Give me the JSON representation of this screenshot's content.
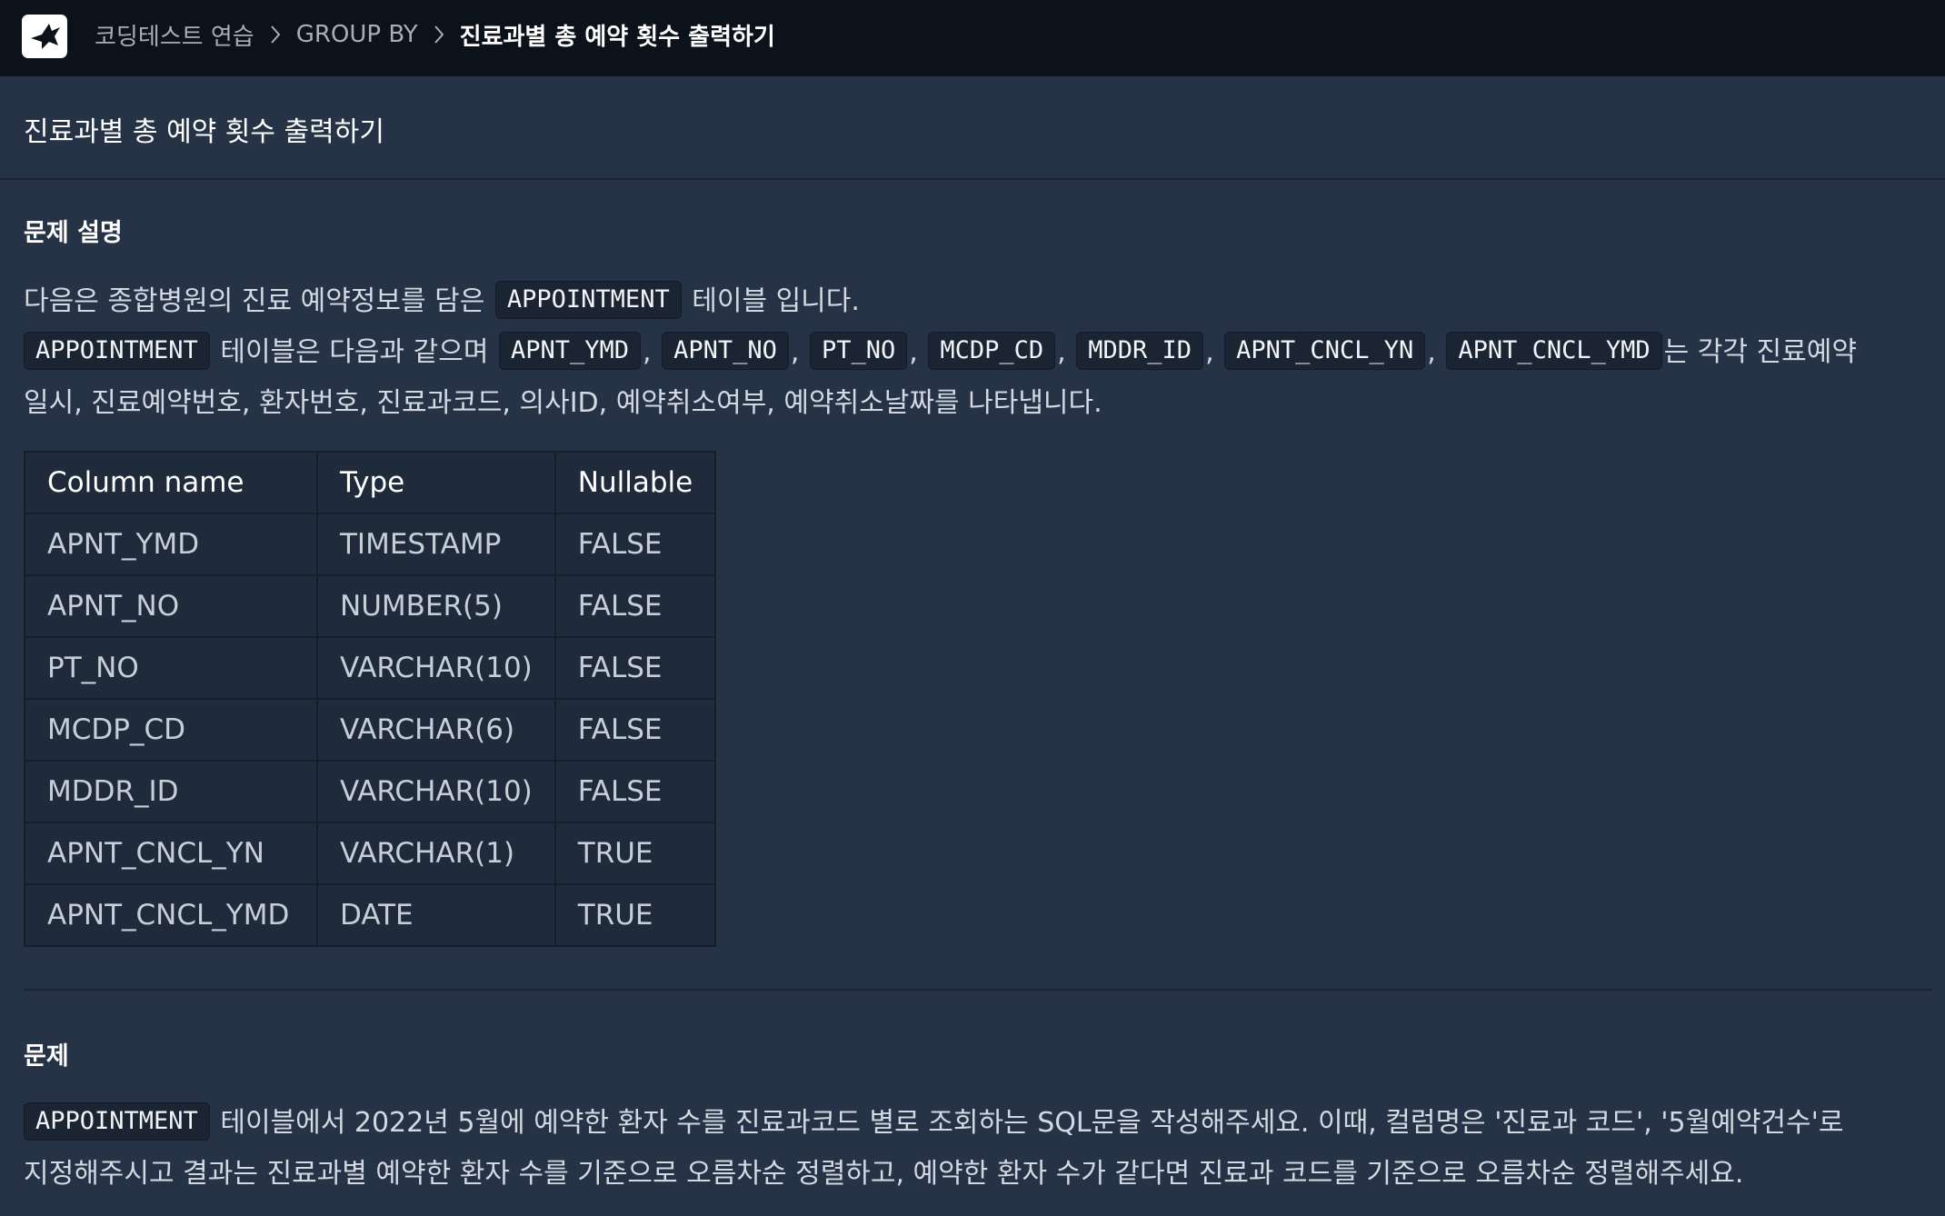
{
  "breadcrumb": {
    "items": [
      "코딩테스트 연습",
      "GROUP BY",
      "진료과별 총 예약 횟수 출력하기"
    ]
  },
  "icons": {
    "logo": "programmers-bird-logo",
    "separator": "chevron-right-icon"
  },
  "page": {
    "title": "진료과별 총 예약 횟수 출력하기"
  },
  "description": {
    "heading": "문제 설명",
    "line1": {
      "before": "다음은 종합병원의 진료 예약정보를 담은 ",
      "code": "APPOINTMENT",
      "after": " 테이블 입니다."
    },
    "line2": {
      "code": "APPOINTMENT",
      "text": " 테이블은 다음과 같으며 ",
      "columns": [
        "APNT_YMD",
        "APNT_NO",
        "PT_NO",
        "MCDP_CD",
        "MDDR_ID",
        "APNT_CNCL_YN",
        "APNT_CNCL_YMD"
      ],
      "sep": ",",
      "after": "는 각각 진료예약"
    },
    "line3": "일시, 진료예약번호, 환자번호, 진료과코드, 의사ID, 예약취소여부, 예약취소날짜를 나타냅니다."
  },
  "schema_table": {
    "headers": [
      "Column name",
      "Type",
      "Nullable"
    ],
    "rows": [
      [
        "APNT_YMD",
        "TIMESTAMP",
        "FALSE"
      ],
      [
        "APNT_NO",
        "NUMBER(5)",
        "FALSE"
      ],
      [
        "PT_NO",
        "VARCHAR(10)",
        "FALSE"
      ],
      [
        "MCDP_CD",
        "VARCHAR(6)",
        "FALSE"
      ],
      [
        "MDDR_ID",
        "VARCHAR(10)",
        "FALSE"
      ],
      [
        "APNT_CNCL_YN",
        "VARCHAR(1)",
        "TRUE"
      ],
      [
        "APNT_CNCL_YMD",
        "DATE",
        "TRUE"
      ]
    ]
  },
  "problem": {
    "heading": "문제",
    "line1": {
      "code": "APPOINTMENT",
      "after": " 테이블에서 2022년 5월에 예약한 환자 수를 진료과코드 별로 조회하는 SQL문을 작성해주세요. 이때, 컬럼명은 '진료과 코드', '5월예약건수'로"
    },
    "line2": "지정해주시고 결과는 진료과별 예약한 환자 수를 기준으로 오름차순 정렬하고, 예약한 환자 수가 같다면 진료과 코드를 기준으로 오름차순 정렬해주세요."
  },
  "colors": {
    "topbar": "#0c1219",
    "background": "#263245",
    "code_bg": "#1b2433"
  }
}
